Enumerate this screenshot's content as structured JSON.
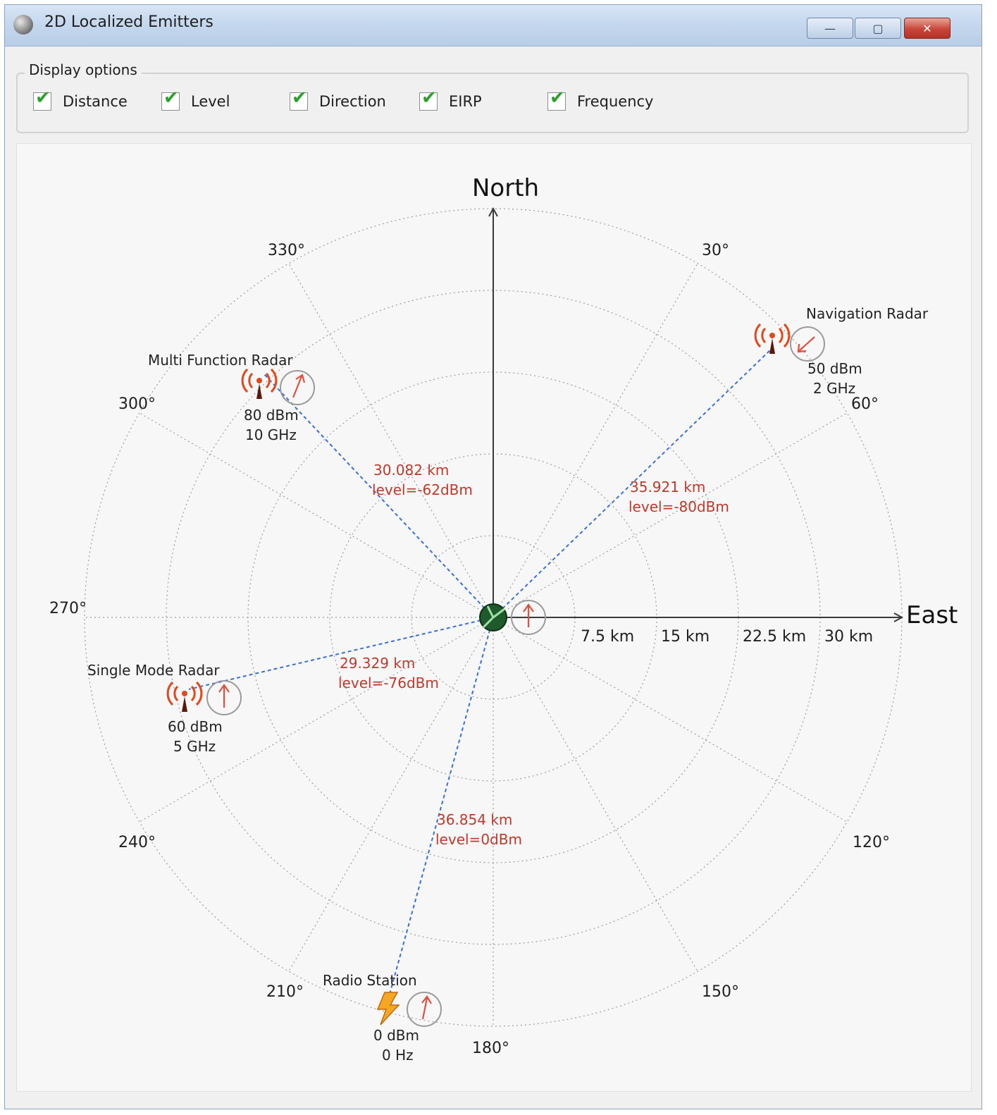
{
  "window": {
    "title": "2D Localized Emitters",
    "minimize_glyph": "—",
    "maximize_glyph": "▢",
    "close_glyph": "✕"
  },
  "display_options": {
    "legend": "Display options",
    "items": [
      {
        "label": "Distance",
        "checked": true
      },
      {
        "label": "Level",
        "checked": true
      },
      {
        "label": "Direction",
        "checked": true
      },
      {
        "label": "EIRP",
        "checked": true
      },
      {
        "label": "Frequency",
        "checked": true
      }
    ]
  },
  "plot": {
    "north_label": "North",
    "east_label": "East",
    "angle_labels": [
      "30°",
      "60°",
      "120°",
      "150°",
      "180°",
      "210°",
      "240°",
      "270°",
      "300°",
      "330°"
    ],
    "distance_labels": [
      "7.5 km",
      "15 km",
      "22.5 km",
      "30 km"
    ],
    "emitters": [
      {
        "name": "Navigation Radar",
        "eirp": "50 dBm",
        "frequency": "2 GHz",
        "distance": "35.921 km",
        "level": "level=-80dBm",
        "icon": "radar-antenna-icon"
      },
      {
        "name": "Multi Function Radar",
        "eirp": "80 dBm",
        "frequency": "10 GHz",
        "distance": "30.082 km",
        "level": "level=-62dBm",
        "icon": "radar-antenna-icon"
      },
      {
        "name": "Single Mode Radar",
        "eirp": "60 dBm",
        "frequency": "5 GHz",
        "distance": "29.329 km",
        "level": "level=-76dBm",
        "icon": "radar-antenna-icon"
      },
      {
        "name": "Radio Station",
        "eirp": "0 dBm",
        "frequency": "0  Hz",
        "distance": "36.854 km",
        "level": "level=0dBm",
        "icon": "lightning-icon"
      }
    ]
  },
  "colors": {
    "link": "#3a6fd6",
    "relation_text": "#c0392b",
    "antenna": "#e04a1c",
    "check": "#2aa12a"
  }
}
